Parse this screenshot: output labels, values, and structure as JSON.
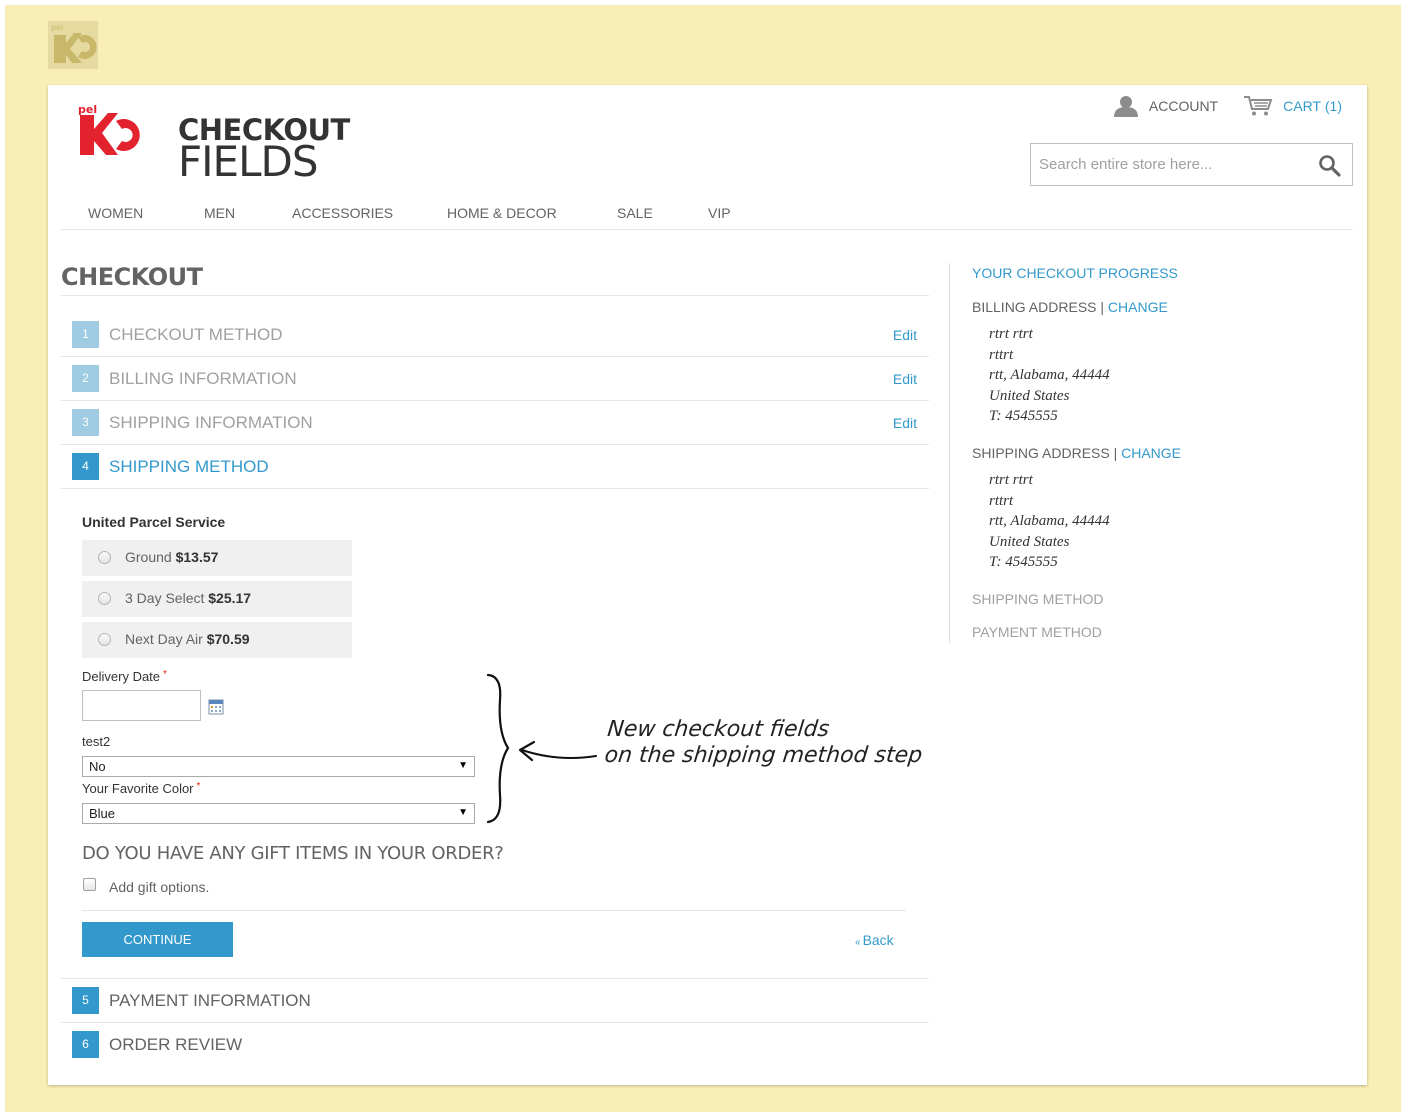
{
  "brand": {
    "logo_line1": "CHECKOUT",
    "logo_line2": "FIELDS",
    "logo_mark_text": "pel",
    "accent": "#3399cc",
    "logo_red": "#e2222d"
  },
  "header": {
    "account_label": "ACCOUNT",
    "cart_label": "CART",
    "cart_count": "(1)",
    "search_placeholder": "Search entire store here..."
  },
  "nav": {
    "items": [
      "WOMEN",
      "MEN",
      "ACCESSORIES",
      "HOME & DECOR",
      "SALE",
      "VIP"
    ]
  },
  "checkout": {
    "title": "CHECKOUT",
    "steps": [
      {
        "num": "1",
        "label": "CHECKOUT METHOD",
        "edit": "Edit"
      },
      {
        "num": "2",
        "label": "BILLING INFORMATION",
        "edit": "Edit"
      },
      {
        "num": "3",
        "label": "SHIPPING INFORMATION",
        "edit": "Edit"
      },
      {
        "num": "4",
        "label": "SHIPPING METHOD"
      },
      {
        "num": "5",
        "label": "PAYMENT INFORMATION"
      },
      {
        "num": "6",
        "label": "ORDER REVIEW"
      }
    ],
    "carrier": "United Parcel Service",
    "rates": [
      {
        "name": "Ground",
        "price": "$13.57"
      },
      {
        "name": "3 Day Select",
        "price": "$25.17"
      },
      {
        "name": "Next Day Air",
        "price": "$70.59"
      }
    ],
    "delivery_date_label": "Delivery Date",
    "required_mark": "*",
    "test2_label": "test2",
    "test2_value": "No",
    "color_label": "Your Favorite Color",
    "color_value": "Blue",
    "gift_question": "DO YOU HAVE ANY GIFT ITEMS IN YOUR ORDER?",
    "gift_option_label": "Add gift options.",
    "continue_label": "CONTINUE",
    "back_arrow": "«",
    "back_label": "Back"
  },
  "annotation": {
    "line1": "New checkout fields",
    "line2": "on the shipping method step"
  },
  "progress": {
    "title": "YOUR CHECKOUT PROGRESS",
    "billing_label": "BILLING ADDRESS",
    "shipping_label": "SHIPPING ADDRESS",
    "separator": "|",
    "change_label": "CHANGE",
    "billing_lines": [
      "rtrt rtrt",
      "rttrt",
      "rtt, Alabama, 44444",
      "United States",
      "T: 4545555"
    ],
    "shipping_lines": [
      "rtrt rtrt",
      "rttrt",
      "rtt, Alabama, 44444",
      "United States",
      "T: 4545555"
    ],
    "shipping_method_label": "SHIPPING METHOD",
    "payment_method_label": "PAYMENT METHOD"
  }
}
